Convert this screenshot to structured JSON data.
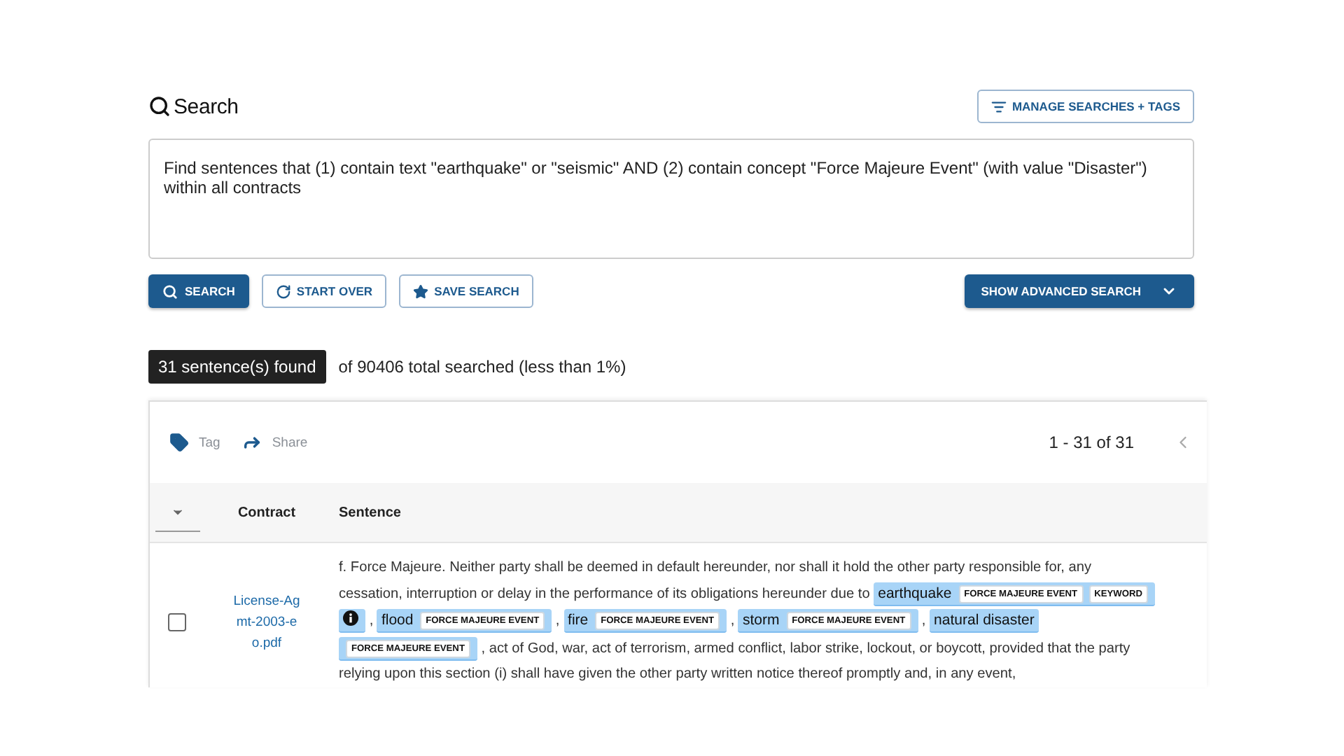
{
  "header": {
    "title": "Search",
    "manage_button": "MANAGE SEARCHES + TAGS"
  },
  "query": {
    "value": "Find sentences that (1) contain text \"earthquake\" or \"seismic\" AND (2) contain concept \"Force Majeure Event\" (with value \"Disaster\") within all contracts"
  },
  "actions": {
    "search": "SEARCH",
    "start_over": "START OVER",
    "save": "SAVE SEARCH",
    "advanced": "SHOW ADVANCED SEARCH"
  },
  "summary": {
    "count": "31 sentence(s) found",
    "detail": "of 90406 total searched (less than 1%)"
  },
  "results": {
    "toolbar": [
      {
        "label": "Tag",
        "kind": "tag"
      },
      {
        "label": "Share",
        "kind": "share"
      }
    ],
    "range": "1 - 31 of 31",
    "columns": [
      "Contract",
      "Sentence"
    ],
    "rows": [
      {
        "checked": false,
        "contract": "License-Agmt-2003-eo.pdf",
        "segments": [
          {
            "kind": "text",
            "text": "f. Force Majeure. Neither party shall be deemed in default hereunder, nor shall it hold the other party responsible for, any cessation, interruption or delay in the performance of its obligations hereunder due to"
          },
          {
            "kind": "hit",
            "text": "earthquake",
            "tags": [
              "FORCE MAJEURE EVENT",
              "KEYWORD"
            ],
            "info": true
          },
          {
            "kind": "text",
            "text": ","
          },
          {
            "kind": "hit",
            "text": "flood",
            "tags": [
              "FORCE MAJEURE EVENT"
            ],
            "info": false
          },
          {
            "kind": "text",
            "text": ","
          },
          {
            "kind": "hit",
            "text": "fire",
            "tags": [
              "FORCE MAJEURE EVENT"
            ],
            "info": false
          },
          {
            "kind": "text",
            "text": ","
          },
          {
            "kind": "hit",
            "text": "storm",
            "tags": [
              "FORCE MAJEURE EVENT"
            ],
            "info": false
          },
          {
            "kind": "text",
            "text": ","
          },
          {
            "kind": "hit",
            "text": "natural disaster",
            "tags": [
              "FORCE MAJEURE EVENT"
            ],
            "info": false
          },
          {
            "kind": "text",
            "text": ", act of God, war, act of terrorism, armed conflict, labor strike, lockout, or boycott, provided that the party relying upon this section (i) shall have given the other party written notice thereof promptly and, in any event,"
          }
        ]
      }
    ]
  }
}
